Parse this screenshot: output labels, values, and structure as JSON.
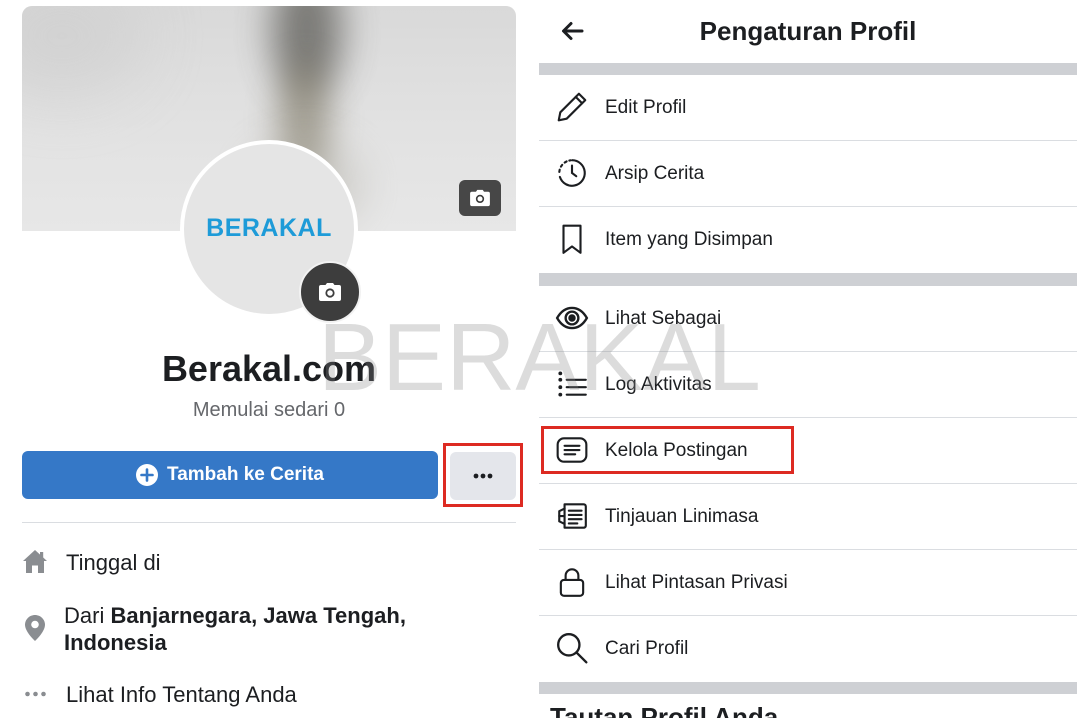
{
  "colors": {
    "primary_button": "#3578c7",
    "more_button_bg": "#e4e6eb",
    "highlight": "#dd2a22",
    "logo_blue": "#1e9bd8",
    "section_bar": "#ced0d4",
    "text_primary": "#1c1e21",
    "text_secondary": "#65676b",
    "icon_gray": "#8a8d91"
  },
  "profile": {
    "cover_camera_icon": "camera-icon",
    "logo_text": "BERAKAL",
    "avatar_camera_icon": "camera-icon",
    "name": "Berakal.com",
    "bio": "Memulai sedari 0",
    "add_story": {
      "icon": "plus-circle-icon",
      "label": "Tambah ke Cerita"
    },
    "more_button": {
      "icon": "more-horizontal-icon",
      "highlighted": true
    },
    "info": {
      "lives_in": {
        "icon": "home-icon",
        "label": "Tinggal di"
      },
      "from": {
        "icon": "location-pin-icon",
        "prefix": "Dari",
        "place": "Banjarnegara, Jawa Tengah, Indonesia"
      },
      "about": {
        "icon": "more-dots-icon",
        "label": "Lihat Info Tentang Anda"
      }
    }
  },
  "settings": {
    "back_icon": "back-arrow-icon",
    "title": "Pengaturan Profil",
    "groups": [
      {
        "items": [
          {
            "icon": "pencil-icon",
            "label": "Edit Profil"
          },
          {
            "icon": "story-archive-icon",
            "label": "Arsip Cerita"
          },
          {
            "icon": "bookmark-icon",
            "label": "Item yang Disimpan"
          }
        ]
      },
      {
        "items": [
          {
            "icon": "eye-icon",
            "label": "Lihat Sebagai"
          },
          {
            "icon": "activity-log-icon",
            "label": "Log Aktivitas"
          },
          {
            "icon": "manage-posts-icon",
            "label": "Kelola Postingan",
            "highlighted": true
          },
          {
            "icon": "timeline-review-icon",
            "label": "Tinjauan Linimasa"
          },
          {
            "icon": "lock-icon",
            "label": "Lihat Pintasan Privasi"
          },
          {
            "icon": "search-icon",
            "label": "Cari Profil"
          }
        ]
      }
    ],
    "next_section_title": "Tautan Profil Anda"
  },
  "watermark": "BERAKAL"
}
